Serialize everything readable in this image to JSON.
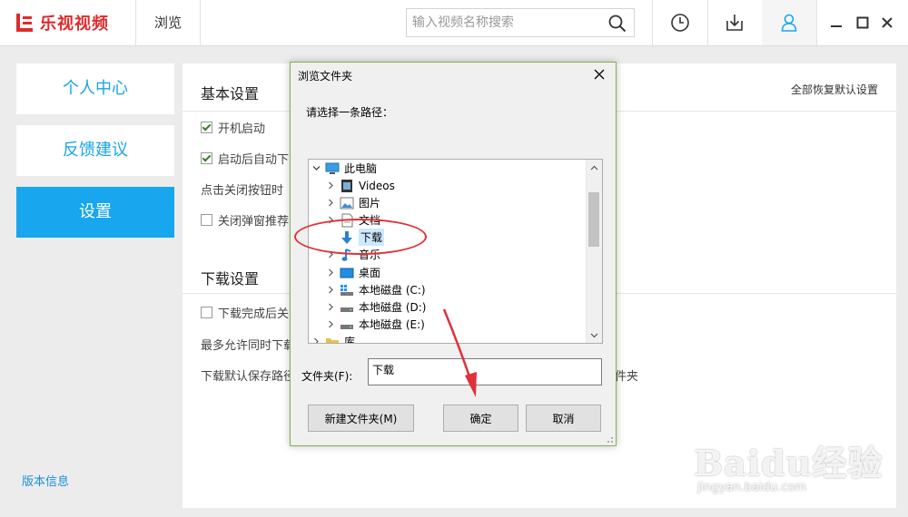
{
  "app": {
    "logo_text": "乐视视频",
    "browse_tab": "浏览",
    "search_placeholder": "输入视频名称搜索"
  },
  "sidebar": {
    "items": [
      {
        "label": "个人中心",
        "active": false
      },
      {
        "label": "反馈建议",
        "active": false
      },
      {
        "label": "设置",
        "active": true
      }
    ],
    "version_link": "版本信息"
  },
  "settings": {
    "basic_title": "基本设置",
    "restore_all": "全部恢复默认设置",
    "basic_rows": [
      {
        "label": "开机启动",
        "checked": true
      },
      {
        "label": "启动后自动下",
        "checked": true
      },
      {
        "label": "点击关闭按钮时"
      },
      {
        "label": "关闭弹窗推荐",
        "checked": false
      }
    ],
    "download_title": "下载设置",
    "download_rows": [
      {
        "label": "下载完成后关",
        "checked": false
      },
      {
        "label": "最多允许同时下载"
      },
      {
        "label": "下载默认保存路径"
      }
    ],
    "path_suffix": "件夹"
  },
  "dialog": {
    "title": "浏览文件夹",
    "prompt": "请选择一条路径：",
    "tree": [
      {
        "label": "此电脑",
        "icon": "computer-icon",
        "expanded": true,
        "level": 0
      },
      {
        "label": "Videos",
        "icon": "video-folder-icon",
        "level": 1
      },
      {
        "label": "图片",
        "icon": "pictures-folder-icon",
        "level": 1
      },
      {
        "label": "文档",
        "icon": "documents-folder-icon",
        "level": 1
      },
      {
        "label": "下载",
        "icon": "download-arrow-icon",
        "level": 1,
        "selected": true
      },
      {
        "label": "音乐",
        "icon": "music-note-icon",
        "level": 1
      },
      {
        "label": "桌面",
        "icon": "desktop-icon",
        "level": 1
      },
      {
        "label": "本地磁盘 (C:)",
        "icon": "system-drive-icon",
        "level": 1
      },
      {
        "label": "本地磁盘 (D:)",
        "icon": "drive-icon",
        "level": 1
      },
      {
        "label": "本地磁盘 (E:)",
        "icon": "drive-icon",
        "level": 1
      },
      {
        "label": "库",
        "icon": "library-folder-icon",
        "level": 0
      }
    ],
    "folder_label": "文件夹(F):",
    "folder_value": "下载",
    "new_folder_button": "新建文件夹(M)",
    "ok_button": "确定",
    "cancel_button": "取消"
  },
  "watermark": {
    "brand": "Baidu经验",
    "url": "jingyan.baidu.com"
  },
  "colors": {
    "brand_red": "#e02a2a",
    "accent_blue": "#18a6ee",
    "dialog_border": "#82b24a",
    "annotation_red": "#e0303a"
  }
}
